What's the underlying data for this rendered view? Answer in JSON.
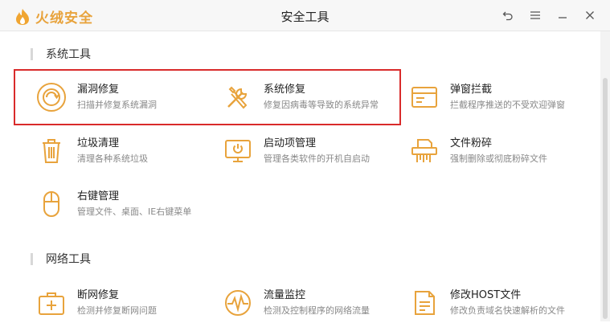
{
  "app": {
    "brand": "火绒安全",
    "window_title": "安全工具"
  },
  "colors": {
    "accent": "#e8a33c",
    "highlight": "#d92b2b"
  },
  "sections": [
    {
      "title": "系统工具",
      "tools": [
        {
          "name": "漏洞修复",
          "desc": "扫描并修复系统漏洞",
          "icon": "vulnerability-repair-icon"
        },
        {
          "name": "系统修复",
          "desc": "修复因病毒等导致的系统异常",
          "icon": "system-repair-icon"
        },
        {
          "name": "弹窗拦截",
          "desc": "拦截程序推送的不受欢迎弹窗",
          "icon": "popup-block-icon"
        },
        {
          "name": "垃圾清理",
          "desc": "清理各种系统垃圾",
          "icon": "trash-icon"
        },
        {
          "name": "启动项管理",
          "desc": "管理各类软件的开机自启动",
          "icon": "startup-icon"
        },
        {
          "name": "文件粉碎",
          "desc": "强制删除或彻底粉碎文件",
          "icon": "shredder-icon"
        },
        {
          "name": "右键管理",
          "desc": "管理文件、桌面、IE右键菜单",
          "icon": "mouse-icon"
        }
      ]
    },
    {
      "title": "网络工具",
      "tools": [
        {
          "name": "断网修复",
          "desc": "检测并修复断网问题",
          "icon": "network-repair-icon"
        },
        {
          "name": "流量监控",
          "desc": "检测及控制程序的网络流量",
          "icon": "traffic-monitor-icon"
        },
        {
          "name": "修改HOST文件",
          "desc": "修改负责域名快速解析的文件",
          "icon": "host-file-icon"
        }
      ]
    }
  ]
}
